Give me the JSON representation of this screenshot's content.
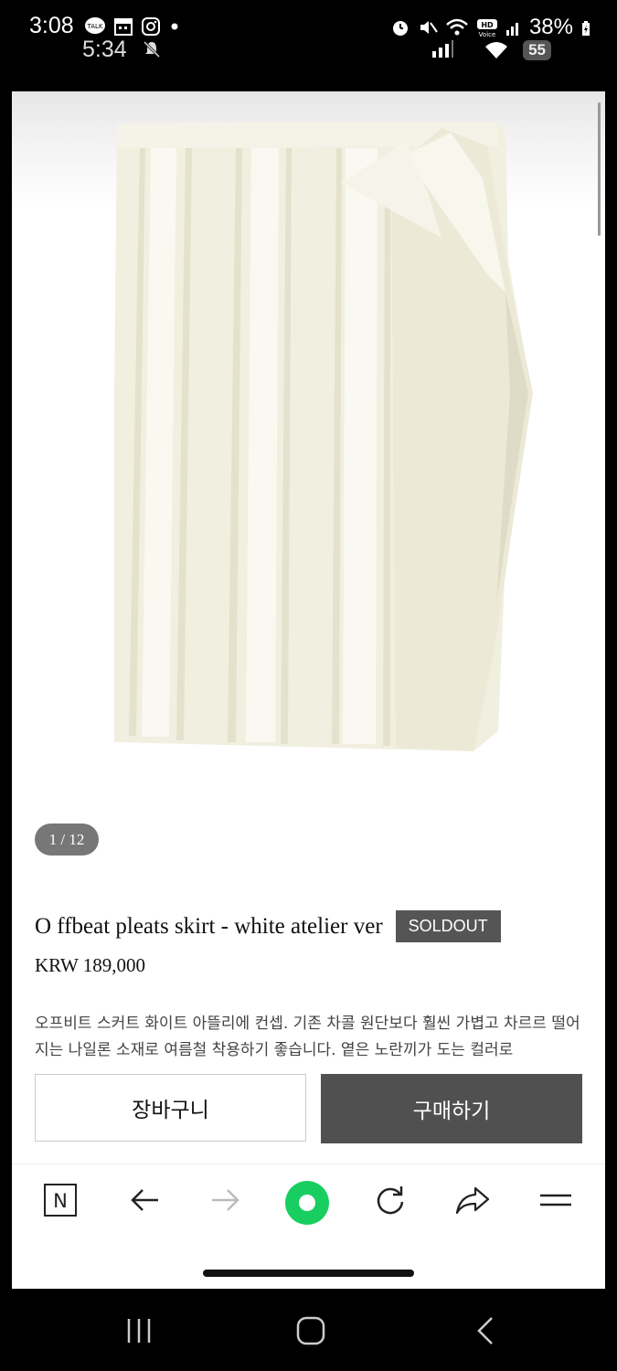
{
  "status_bar": {
    "time": "3:08",
    "secondary_time": "5:34",
    "battery": "38%",
    "badge": "55",
    "icons": [
      "talk-icon",
      "calendar-icon",
      "instagram-icon",
      "dot-icon",
      "alarm-icon",
      "mute-icon",
      "wifi-icon",
      "hd-voice-icon",
      "signal-icon",
      "battery-charging-icon",
      "silent-bell-icon"
    ]
  },
  "product": {
    "image_counter": "1 / 12",
    "title": "O ffbeat pleats skirt - white atelier ver",
    "badge": "SOLDOUT",
    "price": "KRW 189,000",
    "description": "오프비트 스커트 화이트 아뜰리에 컨셉. 기존 차콜 원단보다 훨씬 가볍고 차르르 떨어지는 나일론 소재로 여름철 착용하기 좋습니다. 옅은 노란끼가 도는 컬러로"
  },
  "actions": {
    "cart_label": "장바구니",
    "buy_label": "구매하기"
  },
  "browser_nav": {
    "items": [
      "naver-home-icon",
      "back-icon",
      "forward-icon",
      "green-dot-icon",
      "refresh-icon",
      "share-icon",
      "menu-icon"
    ]
  },
  "colors": {
    "soldout_bg": "#555555",
    "buy_button_bg": "#505050",
    "green_accent": "#19ce60",
    "skirt_color": "#f1efe0"
  }
}
